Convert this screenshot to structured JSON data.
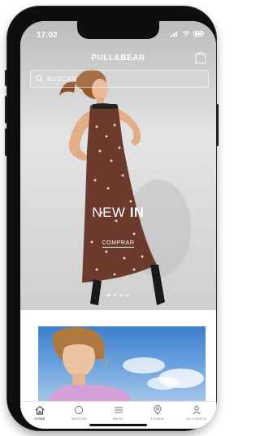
{
  "status": {
    "time": "17:02"
  },
  "brand": "PULL&BEAR",
  "search": {
    "placeholder": "BUSCAR"
  },
  "hero": {
    "title_light": "NEW ",
    "title_bold": "IN",
    "cta": "COMPRAR",
    "slides": 4,
    "active_slide": 1
  },
  "tabbar": {
    "items": [
      {
        "label": "HOME",
        "icon": "home-icon"
      },
      {
        "label": "BUSCAR",
        "icon": "search-icon"
      },
      {
        "label": "MENÚ",
        "icon": "menu-icon"
      },
      {
        "label": "TIENDA",
        "icon": "location-icon"
      },
      {
        "label": "MI CUENTA",
        "icon": "user-icon"
      }
    ]
  },
  "colors": {
    "accent": "#111111",
    "hero_bg": "#d9d9d9",
    "dress": "#6b3a2c",
    "sky": "#4a88d0"
  }
}
